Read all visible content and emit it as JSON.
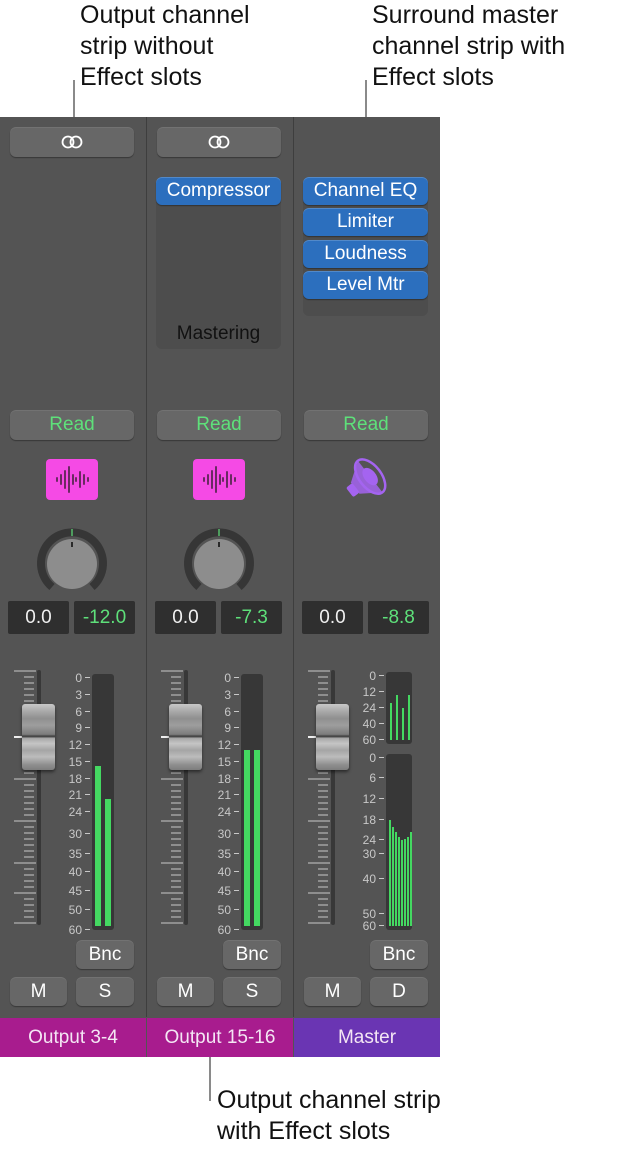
{
  "callouts": {
    "top_left": [
      "Output channel",
      "strip without",
      "Effect slots"
    ],
    "top_right": [
      "Surround master",
      "channel strip with",
      "Effect slots"
    ],
    "bottom": [
      "Output channel strip",
      "with Effect slots"
    ]
  },
  "colors": {
    "mixer_bg": "#545454",
    "plugin_blue": "#2c6fbe",
    "read_green": "#5ee07a",
    "meter_green": "#44d861",
    "output_pink": "#a81c8e",
    "master_purple": "#6a35b3",
    "icon_pink": "#f54ae5",
    "speaker_purple": "#a464f0"
  },
  "strips": [
    {
      "name": "Output 3-4",
      "link_icon": "stereo-link-icon",
      "has_effect_slots": false,
      "plugins": [],
      "slot_label": "",
      "automation": "Read",
      "track_icon": "waveform-icon",
      "pan_value": 0,
      "volume": "0.0",
      "peak": "-12.0",
      "meter_scale": [
        "0",
        "3",
        "6",
        "9",
        "12",
        "15",
        "18",
        "21",
        "24",
        "30",
        "35",
        "40",
        "45",
        "50",
        "60"
      ],
      "meter_levels_db": [
        16,
        22
      ],
      "bounce": "Bnc",
      "mute": "M",
      "solo": "S",
      "name_color": "#a81c8e"
    },
    {
      "name": "Output 15-16",
      "link_icon": "stereo-link-icon",
      "has_effect_slots": true,
      "plugins": [
        "Compressor"
      ],
      "slot_label": "Mastering",
      "automation": "Read",
      "track_icon": "waveform-icon",
      "pan_value": 0,
      "volume": "0.0",
      "peak": "-7.3",
      "meter_scale": [
        "0",
        "3",
        "6",
        "9",
        "12",
        "15",
        "18",
        "21",
        "24",
        "30",
        "35",
        "40",
        "45",
        "50",
        "60"
      ],
      "meter_levels_db": [
        13,
        13
      ],
      "bounce": "Bnc",
      "mute": "M",
      "solo": "S",
      "name_color": "#a81c8e"
    },
    {
      "name": "Master",
      "link_icon": "",
      "has_effect_slots": true,
      "plugins": [
        "Channel EQ",
        "Limiter",
        "Loudness",
        "Level Mtr"
      ],
      "slot_label": "",
      "automation": "Read",
      "track_icon": "speaker-icon",
      "volume": "0.0",
      "peak": "-8.8",
      "surround_meter_top_scale": [
        "0",
        "12",
        "24",
        "40",
        "60"
      ],
      "surround_meter_top_levels_db": [
        20,
        14,
        24,
        14
      ],
      "meter_scale": [
        "0",
        "6",
        "12",
        "18",
        "24",
        "30",
        "40",
        "50",
        "60"
      ],
      "meter_levels_db": [
        18,
        20,
        21.5,
        23,
        24,
        23.5,
        23,
        21.5
      ],
      "bounce": "Bnc",
      "mute": "M",
      "dim": "D",
      "name_color": "#6a35b3"
    }
  ]
}
